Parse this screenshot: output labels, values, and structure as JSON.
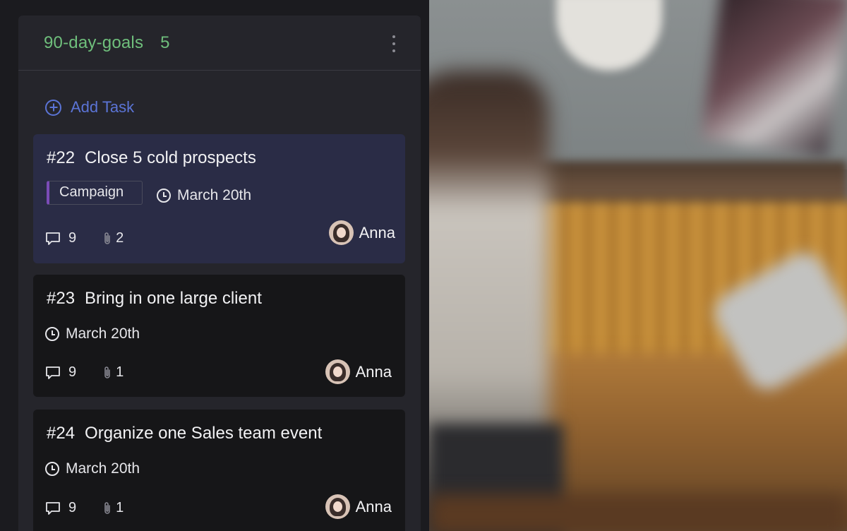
{
  "column": {
    "title": "90-day-goals",
    "count": "5",
    "add_task_label": "Add Task"
  },
  "cards": [
    {
      "number": "#22",
      "title": "Close 5 cold prospects",
      "tag": "Campaign",
      "tag_color": "#7b4bb7",
      "date": "March 20th",
      "comments": "9",
      "attachments": "2",
      "assignee": "Anna",
      "active": true
    },
    {
      "number": "#23",
      "title": "Bring in one large client",
      "date": "March 20th",
      "comments": "9",
      "attachments": "1",
      "assignee": "Anna",
      "active": false
    },
    {
      "number": "#24",
      "title": "Organize one Sales team event",
      "date": "March 20th",
      "comments": "9",
      "attachments": "1",
      "assignee": "Anna",
      "active": false
    }
  ],
  "colors": {
    "column_title": "#6fbf7c",
    "add_task": "#5b74d6",
    "active_card": "#2a2c46",
    "card": "#161618"
  }
}
